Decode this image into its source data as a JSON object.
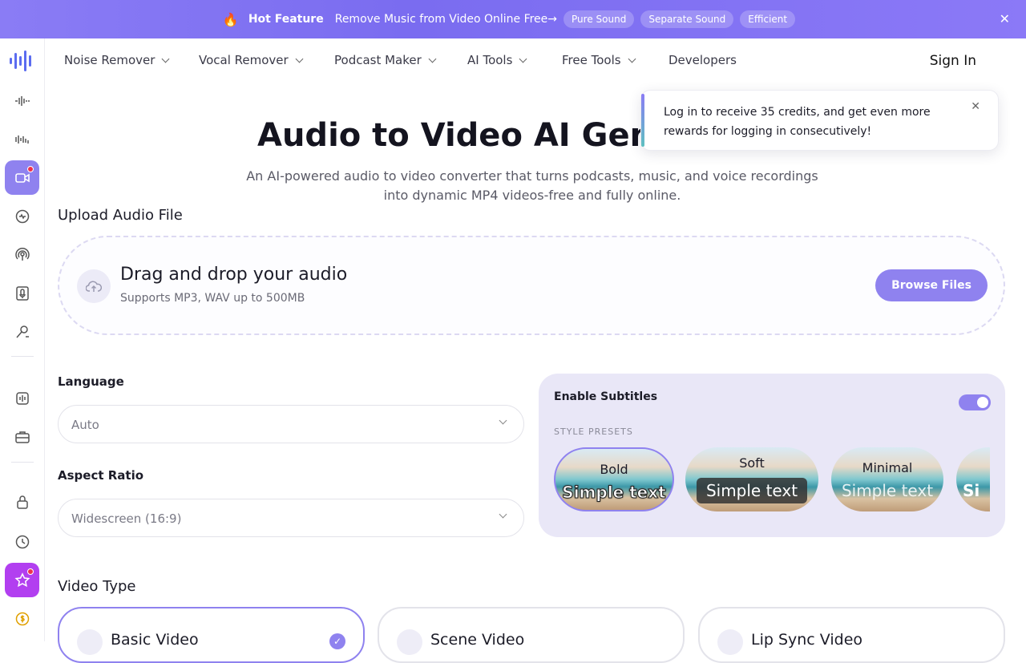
{
  "banner": {
    "hot_label": "Hot Feature",
    "message": "Remove Music from Video Online Free",
    "arrow": "→",
    "pills": [
      "Pure Sound",
      "Separate Sound",
      "Efficient"
    ],
    "close": "✕"
  },
  "nav": {
    "items": [
      "Noise Remover",
      "Vocal Remover",
      "Podcast Maker",
      "AI Tools",
      "Free Tools",
      "Developers"
    ],
    "sign_in": "Sign In"
  },
  "hero": {
    "title": "Audio to Video AI Generator",
    "subtitle": "An AI-powered audio to video converter that turns podcasts, music, and voice recordings into dynamic MP4 videos-free and fully online."
  },
  "toast": {
    "text": "Log in to receive 35 credits, and get even more rewards for logging in consecutively!",
    "close": "✕"
  },
  "upload": {
    "heading": "Upload Audio File",
    "title": "Drag and drop your audio",
    "subtitle": "Supports MP3, WAV up to 500MB",
    "button": "Browse Files"
  },
  "form": {
    "language_label": "Language",
    "language_value": "Auto",
    "aspect_label": "Aspect Ratio",
    "aspect_value": "Widescreen (16:9)"
  },
  "subtitles": {
    "heading": "Enable Subtitles",
    "enabled": true,
    "presets_label": "STYLE PRESETS",
    "presets": [
      {
        "name": "Bold",
        "sample": "Simple text"
      },
      {
        "name": "Soft",
        "sample": "Simple text"
      },
      {
        "name": "Minimal",
        "sample": "Simple text"
      },
      {
        "name": "",
        "sample": "Si"
      }
    ]
  },
  "video_type": {
    "heading": "Video Type",
    "options": [
      "Basic Video",
      "Scene Video",
      "Lip Sync Video"
    ],
    "selected": "Basic Video"
  },
  "colors": {
    "accent": "#8f82ef",
    "banner": "#7a6cf0",
    "premium": "#b23ff0",
    "alert": "#f0304b"
  }
}
